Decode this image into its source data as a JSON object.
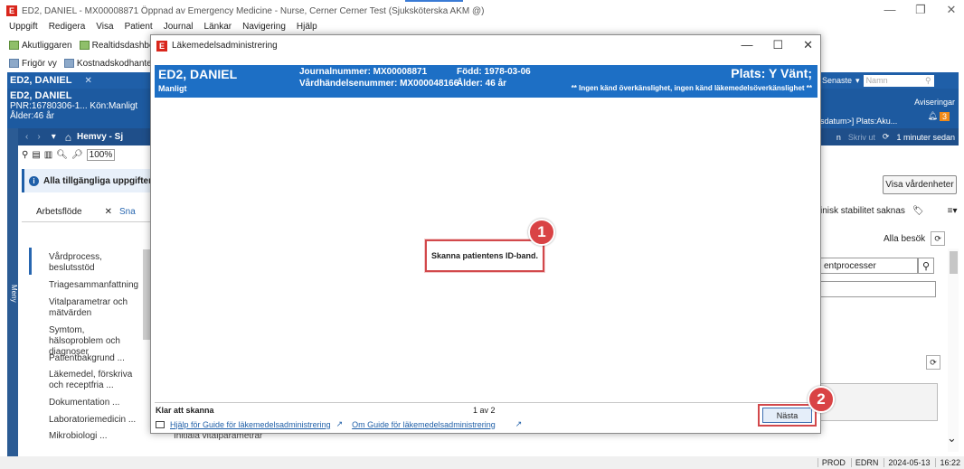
{
  "window": {
    "title": "ED2, DANIEL - MX00008871 Öppnad av Emergency Medicine - Nurse, Cerner Cerner Test (Sjuksköterska AKM @)",
    "app_icon_letter": "E",
    "minimize": "—",
    "restore": "❐",
    "close": "✕"
  },
  "menubar": [
    "Uppgift",
    "Redigera",
    "Visa",
    "Patient",
    "Journal",
    "Länkar",
    "Navigering",
    "Hjälp"
  ],
  "toolbar1": [
    "Akutliggaren",
    "Realtidsdashboar"
  ],
  "toolbar2": [
    "Frigör vy",
    "Kostnadskodhantering"
  ],
  "patient_tab": {
    "label": "ED2, DANIEL",
    "close": "✕"
  },
  "patient_band": {
    "name": "ED2, DANIEL",
    "pnr": "PNR:16780306-1...",
    "kon": "Kön:Manligt",
    "alder": "Ålder:46 år"
  },
  "nav": {
    "home_label": "Hemvy - Sj",
    "menu_label": "Meny"
  },
  "left_toolbar": {
    "zoom": "100%"
  },
  "info_banner": {
    "text": "Alla tillgängliga uppgifter i"
  },
  "left_tabs": {
    "work": "Arbetsflöde",
    "close": "✕",
    "other": "Sna"
  },
  "side_items": [
    "Vårdprocess, beslutsstöd",
    "Triagesammanfattning",
    "Vitalparametrar och mätvärden",
    "Symtom, hälsoproblem och diagnoser",
    "Patientbakgrund ...",
    "Läkemedel, förskriva och receptfria ...",
    "Dokumentation ...",
    "Laboratoriemedicin ...",
    "Mikrobiologi ..."
  ],
  "right": {
    "senaste": "Senaste",
    "search_placeholder": "Namn",
    "aviseringar": "Aviseringar",
    "badge": "3",
    "location": "sdatum>] Plats:Aku...",
    "strip_a": "n",
    "strip_b": "Skriv ut",
    "strip_time": "1 minuter sedan",
    "visa_btn": "Visa vårdenheter",
    "stability": "inisk stabilitet saknas",
    "alla_besok": "Alla besök",
    "proc_field": "entprocesser"
  },
  "behind_bottom": "Initiala vitalparametrar",
  "statusbar": {
    "env": "PROD",
    "user": "EDRN",
    "date": "2024-05-13",
    "time": "16:22"
  },
  "dialog": {
    "title": "Läkemedelsadministrering",
    "band": {
      "name": "ED2, DANIEL",
      "sex": "Manligt",
      "journal": "Journalnummer: MX00008871",
      "vardhandelse": "Vårdhändelsenummer: MX000048166",
      "fodd": "Född: 1978-03-06",
      "alder": "Ålder: 46 år",
      "plats": "Plats: Y Vänt;",
      "allergy": "** Ingen känd överkänslighet, ingen känd läkemedelsöverkänslighet **"
    },
    "scan_prompt": "Skanna patientens ID-band.",
    "callout_1": "1",
    "callout_2": "2",
    "ready": "Klar att skanna",
    "pager": "1 av 2",
    "help_link": "Hjälp för Guide för läkemedelsadministrering",
    "about_link": "Om Guide för läkemedelsadministrering",
    "next_btn": "Nästa"
  }
}
